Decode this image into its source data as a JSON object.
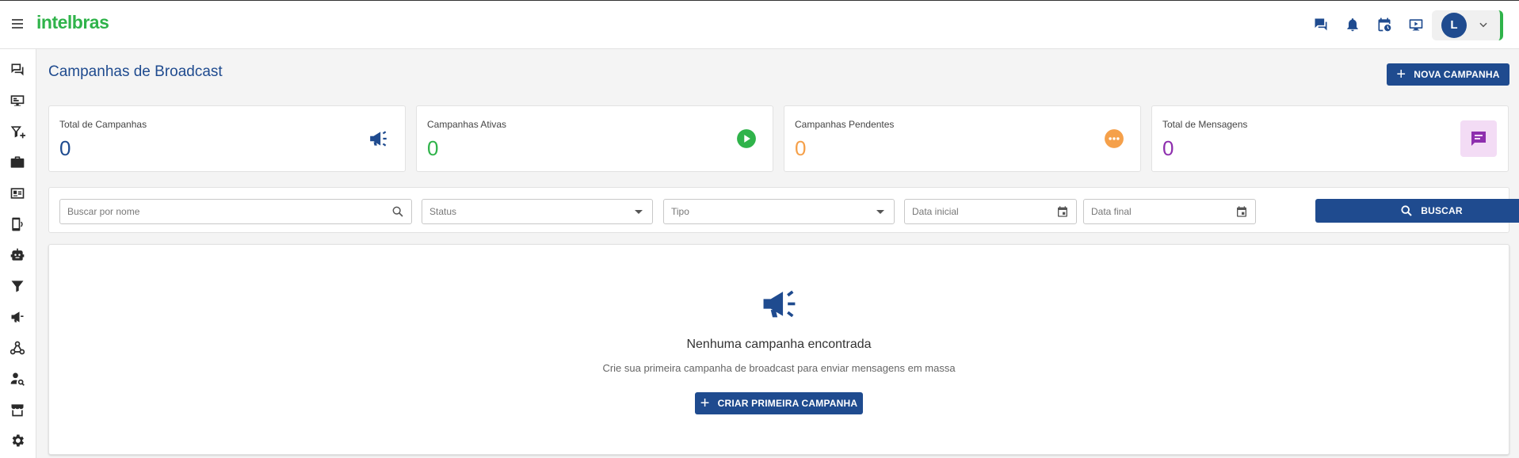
{
  "brand": {
    "logo_text": "intelbras",
    "accent": "#2fb34a",
    "primary": "#1f4b8f"
  },
  "header": {
    "icons": [
      "chat-icon",
      "bell-icon",
      "calendar-clock-icon",
      "monitor-play-icon"
    ],
    "user_initial": "L"
  },
  "sidebar": {
    "items": [
      "chat-icon",
      "monitor-icon",
      "filter-add-icon",
      "briefcase-icon",
      "contact-card-icon",
      "phone-audio-icon",
      "robot-icon",
      "funnel-icon",
      "megaphone-icon",
      "webhook-icon",
      "user-search-icon",
      "store-icon",
      "gear-icon"
    ]
  },
  "page": {
    "title": "Campanhas de Broadcast",
    "new_button": "NOVA CAMPANHA"
  },
  "stats": [
    {
      "label": "Total de Campanhas",
      "value": "0",
      "color": "#1f4b8f",
      "icon": "megaphone-icon"
    },
    {
      "label": "Campanhas Ativas",
      "value": "0",
      "color": "#2fb34a",
      "icon": "play-circle-icon"
    },
    {
      "label": "Campanhas Pendentes",
      "value": "0",
      "color": "#f5a04a",
      "icon": "pending-circle-icon"
    },
    {
      "label": "Total de Mensagens",
      "value": "0",
      "color": "#8e2fae",
      "icon": "message-icon"
    }
  ],
  "filters": {
    "search_placeholder": "Buscar por nome",
    "status_placeholder": "Status",
    "type_placeholder": "Tipo",
    "start_date_placeholder": "Data inicial",
    "end_date_placeholder": "Data final",
    "search_button": "BUSCAR"
  },
  "empty_state": {
    "title": "Nenhuma campanha encontrada",
    "subtitle": "Crie sua primeira campanha de broadcast para enviar mensagens em massa",
    "button": "CRIAR PRIMEIRA CAMPANHA"
  }
}
